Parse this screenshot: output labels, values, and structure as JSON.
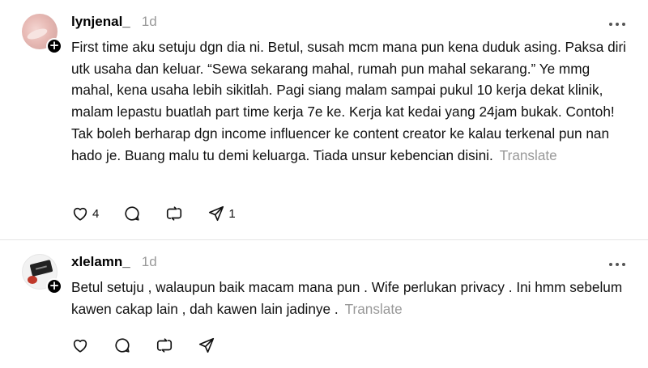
{
  "posts": [
    {
      "username": "lynjenal_",
      "time": "1d",
      "text": "First time aku setuju dgn dia ni. Betul, susah mcm mana pun kena duduk asing. Paksa diri utk usaha dan keluar. “Sewa sekarang mahal, rumah pun mahal sekarang.” Ye mmg mahal, kena usaha lebih sikitlah. Pagi siang malam sampai pukul 10 kerja dekat klinik, malam lepastu buatlah part time kerja 7e ke. Kerja kat kedai yang 24jam bukak. Contoh! Tak boleh berharap dgn income influencer ke content creator ke kalau terkenal pun nan hado je. Buang malu tu demi keluarga. Tiada unsur kebencian disini.",
      "translate_label": "Translate",
      "like_count": "4",
      "share_count": "1",
      "icons": [
        "heart-icon",
        "comment-icon",
        "repost-icon",
        "share-icon"
      ]
    },
    {
      "username": "xlelamn_",
      "time": "1d",
      "text": "Betul setuju , walaupun baik macam mana pun . Wife perlukan privacy . Ini hmm sebelum kawen cakap lain , dah kawen lain jadinye .",
      "translate_label": "Translate",
      "like_count": "",
      "share_count": "",
      "icons": [
        "heart-icon",
        "comment-icon",
        "repost-icon",
        "share-icon"
      ]
    }
  ],
  "badge_symbol": "+",
  "colors": {
    "muted": "#999999",
    "text": "#111111",
    "divider": "#e5e5e5"
  }
}
